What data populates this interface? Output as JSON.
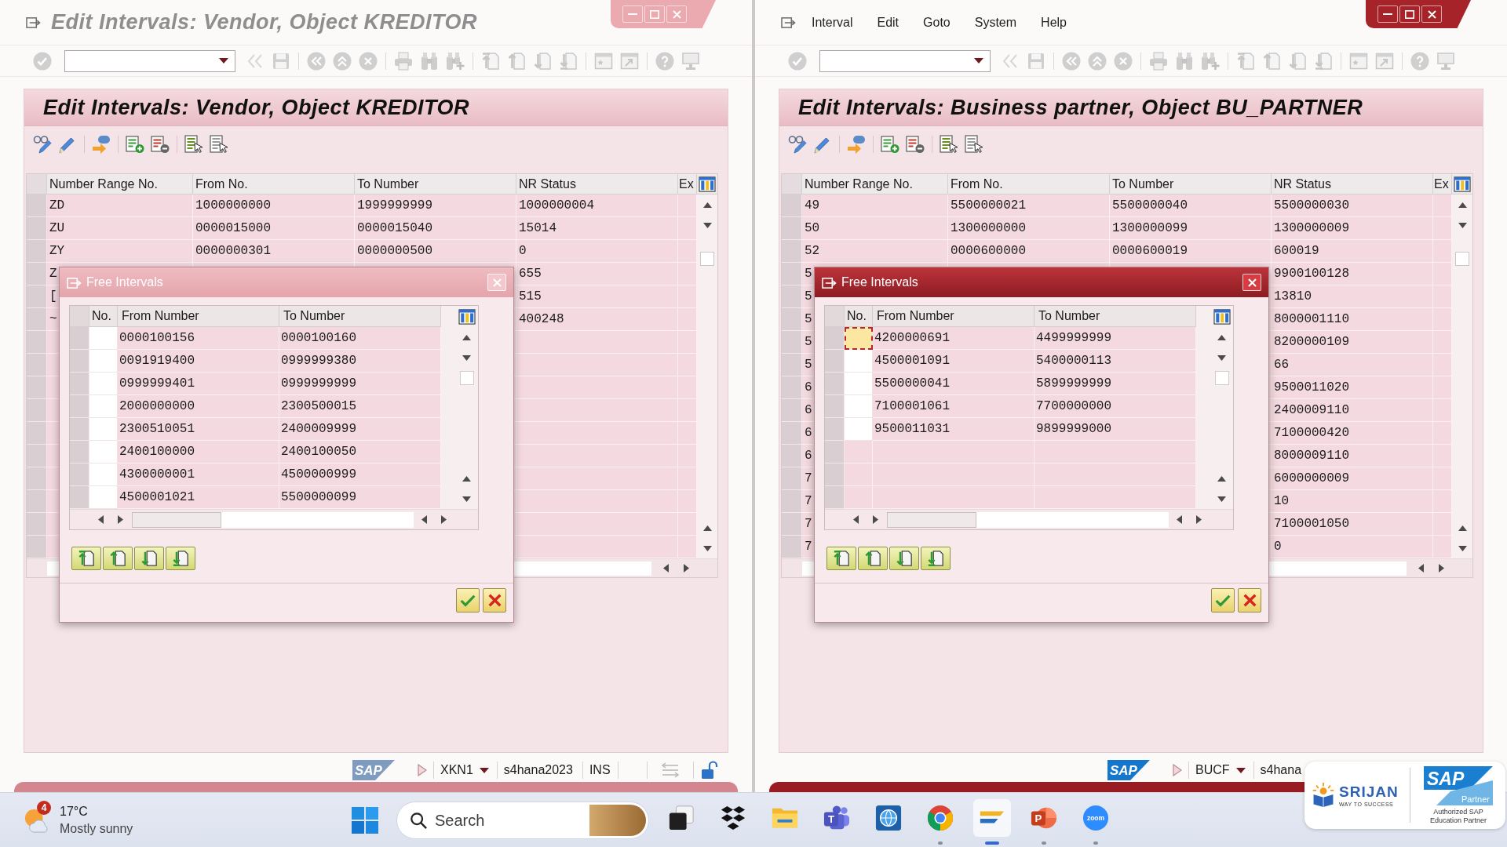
{
  "windows": [
    {
      "active": false,
      "title": "Edit Intervals: Vendor, Object KREDITOR",
      "heading": "Edit Intervals: Vendor, Object KREDITOR",
      "table": {
        "columns": [
          "Number Range No.",
          "From No.",
          "To Number",
          "NR Status",
          "Ex"
        ],
        "rows": [
          {
            "number_range": "ZD",
            "from": "1000000000",
            "to": "1999999999",
            "status": "1000000004"
          },
          {
            "number_range": "ZU",
            "from": "0000015000",
            "to": "0000015040",
            "status": "15014"
          },
          {
            "number_range": "ZY",
            "from": "0000000301",
            "to": "0000000500",
            "status": "0"
          },
          {
            "number_range": "Z",
            "status": "655"
          },
          {
            "number_range": "[",
            "status": "515"
          },
          {
            "number_range": "~",
            "status": "400248"
          }
        ]
      },
      "dialog": {
        "active": false,
        "title": "Free Intervals",
        "columns": [
          "No.",
          "From Number",
          "To Number"
        ],
        "rows": [
          {
            "from": "0000100156",
            "to": "0000100160",
            "selected": false
          },
          {
            "from": "0091919400",
            "to": "0999999380",
            "selected": false
          },
          {
            "from": "0999999401",
            "to": "0999999999",
            "selected": false
          },
          {
            "from": "2000000000",
            "to": "2300500015",
            "selected": false
          },
          {
            "from": "2300510051",
            "to": "2400009999",
            "selected": false
          },
          {
            "from": "2400100000",
            "to": "2400100050",
            "selected": false
          },
          {
            "from": "4300000001",
            "to": "4500000999",
            "selected": false
          },
          {
            "from": "4500001021",
            "to": "5500000099",
            "selected": false
          }
        ]
      },
      "status_bar": {
        "logo": "SAP",
        "transaction": "XKN1",
        "system": "s4hana2023",
        "mode": "INS"
      }
    },
    {
      "active": true,
      "menu": [
        "Interval",
        "Edit",
        "Goto",
        "System",
        "Help"
      ],
      "heading": "Edit Intervals: Business partner, Object BU_PARTNER",
      "table": {
        "columns": [
          "Number Range No.",
          "From No.",
          "To Number",
          "NR Status",
          "Ex"
        ],
        "rows": [
          {
            "number_range": "49",
            "from": "5500000021",
            "to": "5500000040",
            "status": "5500000030"
          },
          {
            "number_range": "50",
            "from": "1300000000",
            "to": "1300000099",
            "status": "1300000009"
          },
          {
            "number_range": "52",
            "from": "0000600000",
            "to": "0000600019",
            "status": "600019"
          },
          {
            "number_range": "5",
            "status": "9900100128"
          },
          {
            "number_range": "5",
            "status": "13810"
          },
          {
            "number_range": "5",
            "status": "8000001110"
          },
          {
            "number_range": "5",
            "status": "8200000109"
          },
          {
            "number_range": "5",
            "status": "66"
          },
          {
            "number_range": "6",
            "status": "9500011020"
          },
          {
            "number_range": "6",
            "status": "2400009110"
          },
          {
            "number_range": "6",
            "status": "7100000420"
          },
          {
            "number_range": "6",
            "status": "8000009110"
          },
          {
            "number_range": "7",
            "status": "6000000009"
          },
          {
            "number_range": "7",
            "status": "10"
          },
          {
            "number_range": "7",
            "status": "7100001050"
          },
          {
            "number_range": "7",
            "status": "0"
          }
        ]
      },
      "dialog": {
        "active": true,
        "title": "Free Intervals",
        "columns": [
          "No.",
          "From Number",
          "To Number"
        ],
        "rows": [
          {
            "from": "4200000691",
            "to": "4499999999",
            "selected": true
          },
          {
            "from": "4500001091",
            "to": "5400000113",
            "selected": false
          },
          {
            "from": "5500000041",
            "to": "5899999999",
            "selected": false
          },
          {
            "from": "7100001061",
            "to": "7700000000",
            "selected": false
          },
          {
            "from": "9500011031",
            "to": "9899999000",
            "selected": false
          }
        ]
      },
      "status_bar": {
        "logo": "SAP",
        "transaction": "BUCF",
        "system": "s4hana"
      }
    }
  ],
  "taskbar": {
    "weather": {
      "badge": "4",
      "temperature": "17°C",
      "condition": "Mostly sunny"
    },
    "search": {
      "placeholder": "Search"
    },
    "apps": [
      {
        "kind": "task_view",
        "running": false,
        "active": false
      },
      {
        "kind": "dropbox",
        "running": false,
        "active": false
      },
      {
        "kind": "file_explorer",
        "running": false,
        "active": false
      },
      {
        "kind": "teams",
        "logo_text": "T",
        "running": false,
        "active": false
      },
      {
        "kind": "globe_app",
        "running": false,
        "active": false
      },
      {
        "kind": "chrome",
        "running": true,
        "active": false
      },
      {
        "kind": "sap_logon",
        "running": true,
        "active": true
      },
      {
        "kind": "powerpoint",
        "logo_text": "P",
        "running": true,
        "active": false
      },
      {
        "kind": "zoom",
        "logo_text": "zoom",
        "running": true,
        "active": false
      }
    ]
  },
  "partner_badge": {
    "brand": "SRIJAN",
    "tagline": "WAY TO SUCCESS",
    "partner_logo": "SAP",
    "partner_label": "Partner",
    "caption": "Authorized SAP Education Partner"
  }
}
